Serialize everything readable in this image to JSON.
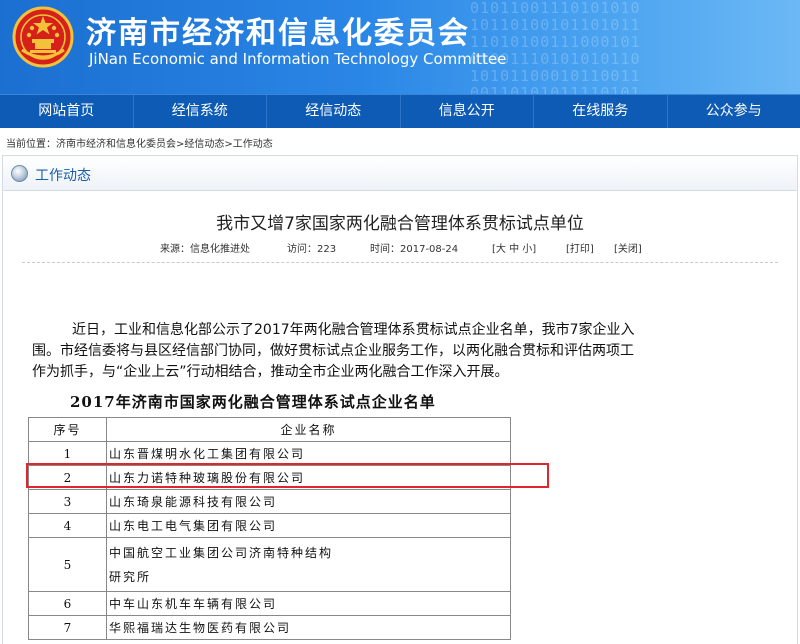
{
  "header": {
    "title": "济南市经济和信息化委员会",
    "subtitle": "JiNan Economic and Information Technology Committee"
  },
  "nav": {
    "items": [
      "网站首页",
      "经信系统",
      "经信动态",
      "信息公开",
      "在线服务",
      "公众参与"
    ]
  },
  "breadcrumb": "当前位置：济南市经济和信息化委员会>经信动态>工作动态",
  "section": {
    "label": "工作动态"
  },
  "article": {
    "title": "我市又增7家国家两化融合管理体系贯标试点单位",
    "source": "来源：信息化推进处",
    "visits": "访问：223",
    "time": "时间：2017-08-24",
    "font_sizes": "[大 中 小]",
    "print": "[打印]",
    "close": "[关闭]",
    "paragraph_lines": [
      "近日，工业和信息化部公示了2017年两化融合管理体系贯标试点企业名单，我市7家企业入",
      "围。市经信委将与县区经信部门协同，做好贯标试点企业服务工作，以两化融合贯标和评估两项工",
      "作为抓手，与“企业上云”行动相结合，推动全市企业两化融合工作深入开展。"
    ],
    "table_caption": "2017年济南市国家两化融合管理体系试点企业名单",
    "table": {
      "headers": [
        "序号",
        "企业名称"
      ],
      "rows": [
        {
          "no": "1",
          "name": "山东晋煤明水化工集团有限公司",
          "name2": ""
        },
        {
          "no": "2",
          "name": "山东力诺特种玻璃股份有限公司",
          "name2": ""
        },
        {
          "no": "3",
          "name": "山东琦泉能源科技有限公司",
          "name2": ""
        },
        {
          "no": "4",
          "name": "山东电工电气集团有限公司",
          "name2": ""
        },
        {
          "no": "5",
          "name": "中国航空工业集团公司济南特种结构",
          "name2": "研究所"
        },
        {
          "no": "6",
          "name": "中车山东机车车辆有限公司",
          "name2": ""
        },
        {
          "no": "7",
          "name": "华熙福瑞达生物医药有限公司",
          "name2": ""
        }
      ]
    }
  },
  "colors": {
    "nav_background": "#0d5bb5",
    "highlight_border": "#e0252f",
    "section_label": "#1d5ea8"
  }
}
